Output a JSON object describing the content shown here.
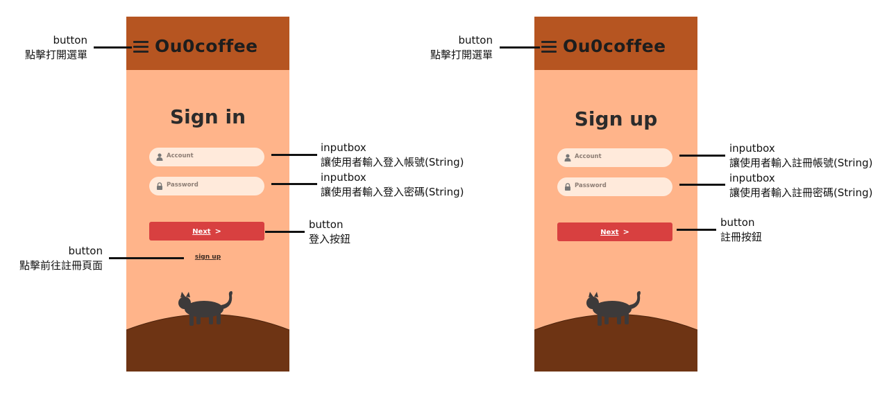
{
  "left_screen": {
    "brand": "Ou0coffee",
    "title": "Sign in",
    "account_placeholder": "Account",
    "password_placeholder": "Password",
    "next_label": "Next",
    "next_arrow": ">",
    "signup_link": "sign up"
  },
  "right_screen": {
    "brand": "Ou0coffee",
    "title": "Sign up",
    "account_placeholder": "Account",
    "password_placeholder": "Password",
    "next_label": "Next",
    "next_arrow": ">"
  },
  "annotations_left": {
    "menu": {
      "type": "button",
      "desc": "點擊打開選單"
    },
    "account": {
      "type": "inputbox",
      "desc": "讓使用者輸入登入帳號(String)"
    },
    "password": {
      "type": "inputbox",
      "desc": "讓使用者輸入登入密碼(String)"
    },
    "login": {
      "type": "button",
      "desc": "登入按鈕"
    },
    "signup": {
      "type": "button",
      "desc": "點擊前往註冊頁面"
    }
  },
  "annotations_right": {
    "menu": {
      "type": "button",
      "desc": "點擊打開選單"
    },
    "account": {
      "type": "inputbox",
      "desc": "讓使用者輸入註冊帳號(String)"
    },
    "password": {
      "type": "inputbox",
      "desc": "讓使用者輸入註冊密碼(String)"
    },
    "register": {
      "type": "button",
      "desc": "註冊按鈕"
    }
  },
  "colors": {
    "header": "#B65521",
    "background": "#FFB48A",
    "input": "#FFEADB",
    "button": "#D84040",
    "hill": "#6E3414",
    "cat": "#3D3A3A"
  },
  "icons": [
    "hamburger-icon",
    "user-icon",
    "lock-icon",
    "chevron-right-icon",
    "cat-illustration"
  ]
}
